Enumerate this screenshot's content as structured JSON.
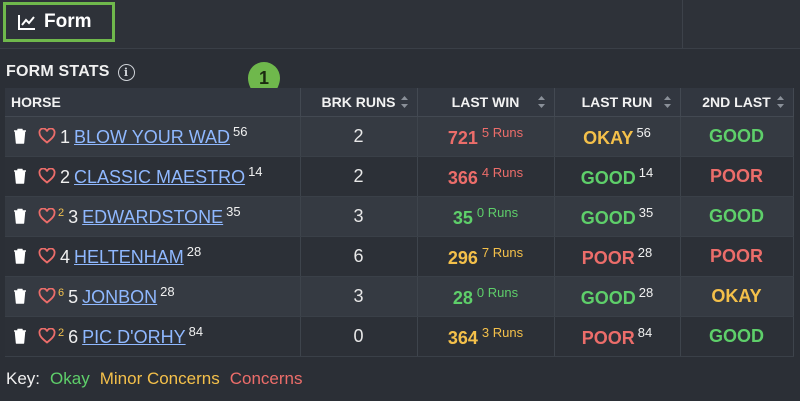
{
  "topbar": {
    "form_tab_label": "Form",
    "form_tab_icon": "line-chart-icon"
  },
  "section": {
    "title": "FORM STATS",
    "info_icon": "i"
  },
  "marker": {
    "label": "1",
    "color": "#6fb84c"
  },
  "table": {
    "headers": [
      "HORSE",
      "BRK RUNS",
      "LAST WIN",
      "LAST RUN",
      "2ND LAST"
    ],
    "rows": [
      {
        "badge": "",
        "num": "1",
        "name": "BLOW YOUR WAD",
        "sup": "56",
        "brk": "2",
        "last_win": "721",
        "last_win_runs": "5 Runs",
        "last_win_color": "red",
        "last_run": "OKAY",
        "last_run_sup": "56",
        "last_run_color": "yellow",
        "second_last": "GOOD",
        "second_last_color": "green"
      },
      {
        "badge": "",
        "num": "2",
        "name": "CLASSIC MAESTRO",
        "sup": "14",
        "brk": "2",
        "last_win": "366",
        "last_win_runs": "4 Runs",
        "last_win_color": "red",
        "last_run": "GOOD",
        "last_run_sup": "14",
        "last_run_color": "green",
        "second_last": "POOR",
        "second_last_color": "red"
      },
      {
        "badge": "2",
        "num": "3",
        "name": "EDWARDSTONE",
        "sup": "35",
        "brk": "3",
        "last_win": "35",
        "last_win_runs": "0 Runs",
        "last_win_color": "green",
        "last_run": "GOOD",
        "last_run_sup": "35",
        "last_run_color": "green",
        "second_last": "GOOD",
        "second_last_color": "green"
      },
      {
        "badge": "",
        "num": "4",
        "name": "HELTENHAM",
        "sup": "28",
        "brk": "6",
        "last_win": "296",
        "last_win_runs": "7 Runs",
        "last_win_color": "yellow",
        "last_run": "POOR",
        "last_run_sup": "28",
        "last_run_color": "red",
        "second_last": "POOR",
        "second_last_color": "red"
      },
      {
        "badge": "6",
        "num": "5",
        "name": "JONBON",
        "sup": "28",
        "brk": "3",
        "last_win": "28",
        "last_win_runs": "0 Runs",
        "last_win_color": "green",
        "last_run": "GOOD",
        "last_run_sup": "28",
        "last_run_color": "green",
        "second_last": "OKAY",
        "second_last_color": "yellow"
      },
      {
        "badge": "2",
        "num": "6",
        "name": "PIC D'ORHY",
        "sup": "84",
        "brk": "0",
        "last_win": "364",
        "last_win_runs": "3 Runs",
        "last_win_color": "yellow",
        "last_run": "POOR",
        "last_run_sup": "84",
        "last_run_color": "red",
        "second_last": "GOOD",
        "second_last_color": "green"
      }
    ]
  },
  "key": {
    "label": "Key:",
    "okay": "Okay",
    "minor": "Minor Concerns",
    "concerns": "Concerns"
  },
  "colors": {
    "green": "#5ecf6a",
    "yellow": "#f4c04a",
    "red": "#ec6d6a",
    "link": "#8fb8ff",
    "accent": "#6fb84c"
  }
}
